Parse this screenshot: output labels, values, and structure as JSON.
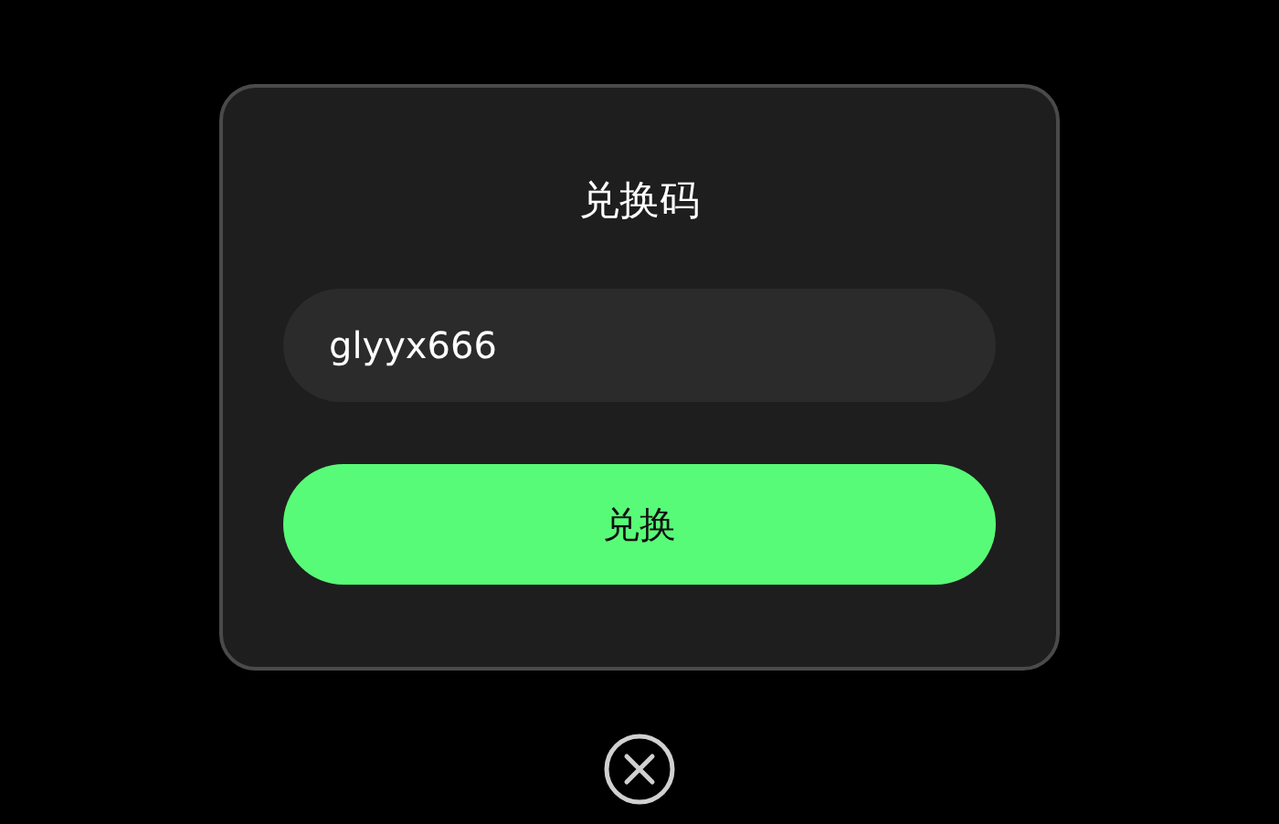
{
  "dialog": {
    "title": "兑换码",
    "code_field": {
      "value": "glyyx666"
    },
    "redeem_button": {
      "label": "兑换"
    }
  }
}
